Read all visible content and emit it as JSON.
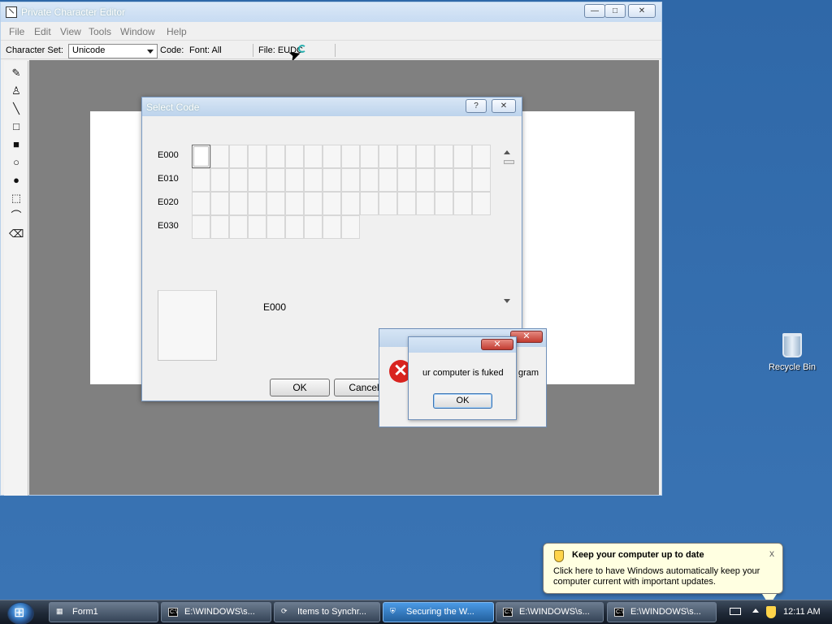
{
  "desktop": {
    "recycle_bin_label": "Recycle Bin"
  },
  "main_window": {
    "title": "Private Character Editor",
    "buttons": {
      "minimize": "—",
      "maximize": "□",
      "close": "✕"
    },
    "menu": [
      "File",
      "Edit",
      "View",
      "Tools",
      "Window",
      "Help"
    ],
    "toolbar": {
      "character_set_label": "Character Set:",
      "character_set_value": "Unicode",
      "code_label": "Code:",
      "font_label": "Font: All",
      "file_label": "File: EUDC"
    },
    "tools": [
      "pencil-icon",
      "brush-icon",
      "line-icon",
      "rectangle-icon",
      "filled-rectangle-icon",
      "ellipse-icon",
      "filled-ellipse-icon",
      "rectangular-select-icon",
      "freeform-select-icon",
      "eraser-icon"
    ]
  },
  "select_code_dialog": {
    "title": "Select Code",
    "help_button": "?",
    "close_button": "✕",
    "rows": [
      {
        "code": "E000",
        "cells": 16
      },
      {
        "code": "E010",
        "cells": 16
      },
      {
        "code": "E020",
        "cells": 16
      },
      {
        "code": "E030",
        "cells": 9
      }
    ],
    "selected_code": "E000",
    "ok_button": "OK",
    "cancel_button": "Cancel"
  },
  "error_dialog_back": {
    "close_button": "✕",
    "icon": "✕",
    "message_fragment": "gram"
  },
  "error_dialog_front": {
    "close_button": "✕",
    "message": "ur computer is fuked",
    "ok_button": "OK"
  },
  "taskbar": {
    "items": [
      {
        "label": "Form1",
        "icon": "form-icon",
        "active": false
      },
      {
        "label": "E:\\WINDOWS\\s...",
        "icon": "cmd-icon",
        "active": false
      },
      {
        "label": "Items to Synchr...",
        "icon": "sync-icon",
        "active": false
      },
      {
        "label": "Securing the W...",
        "icon": "security-icon",
        "active": true
      },
      {
        "label": "E:\\WINDOWS\\s...",
        "icon": "cmd-icon",
        "active": false
      },
      {
        "label": "E:\\WINDOWS\\s...",
        "icon": "cmd-icon",
        "active": false
      }
    ],
    "clock": "12:11 AM"
  },
  "notification": {
    "title": "Keep your computer up to date",
    "message": "Click here to have Windows automatically keep your computer current with important updates.",
    "close": "x"
  }
}
